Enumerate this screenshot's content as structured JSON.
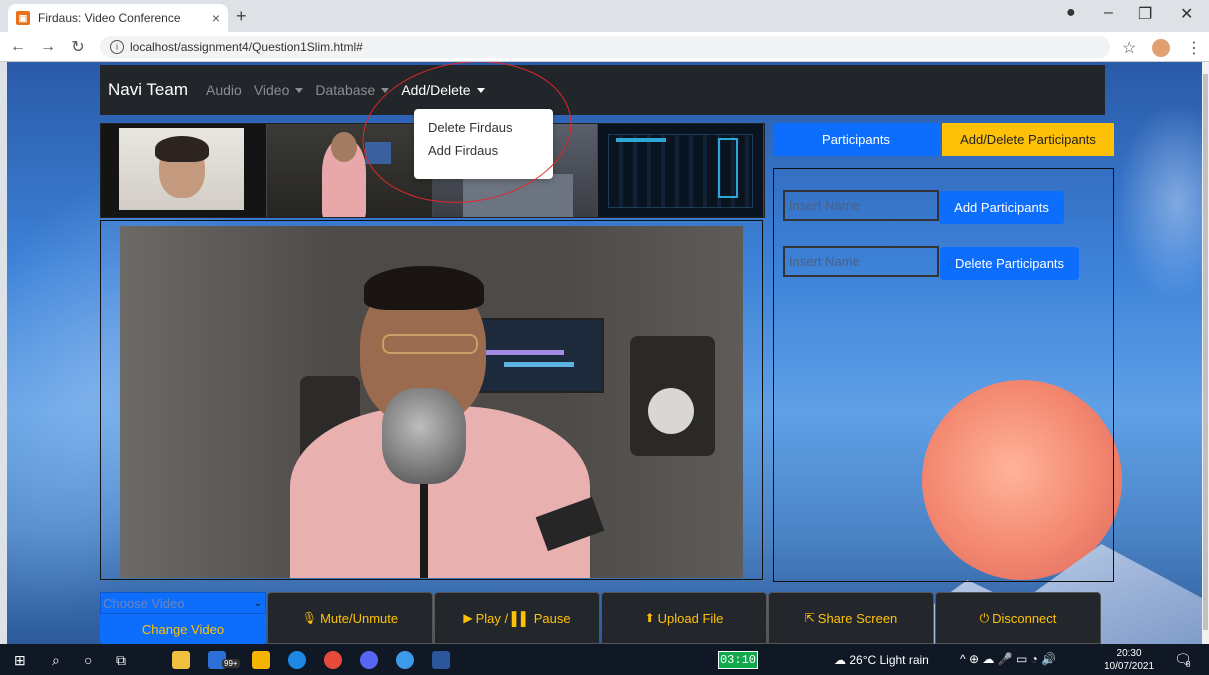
{
  "browser": {
    "tab_title": "Firdaus: Video Conference",
    "tab_close": "×",
    "new_tab": "+",
    "url": "localhost/assignment4/Question1Slim.html#",
    "info_symbol": "i"
  },
  "navbar": {
    "brand": "Navi Team",
    "links": {
      "audio": "Audio",
      "video": "Video",
      "database": "Database",
      "add_delete": "Add/Delete"
    }
  },
  "dropdown": {
    "items": [
      "Delete Firdaus",
      "Add Firdaus"
    ]
  },
  "right_panel": {
    "tab_participants": "Participants",
    "tab_add_delete": "Add/Delete Participants",
    "input1_placeholder": "Insert Name",
    "input2_placeholder": "Insert Name",
    "add_button": "Add Participants",
    "delete_button": "Delete Participants"
  },
  "controls": {
    "choose_video": "Choose Video",
    "change_video": "Change Video",
    "mute": "Mute/Unmute",
    "play_pause": "Play / ▌▌ Pause",
    "upload": "Upload File",
    "share": "Share Screen",
    "disconnect": "Disconnect"
  },
  "taskbar": {
    "badge": "99+",
    "timer": "03:10",
    "weather": "26°C  Light rain",
    "time": "20:30",
    "date": "10/07/2021",
    "notification_count": "8"
  },
  "colors": {
    "primary": "#0d6efd",
    "warning": "#ffc107",
    "navbar": "#222529",
    "annotation": "#e0282a"
  }
}
